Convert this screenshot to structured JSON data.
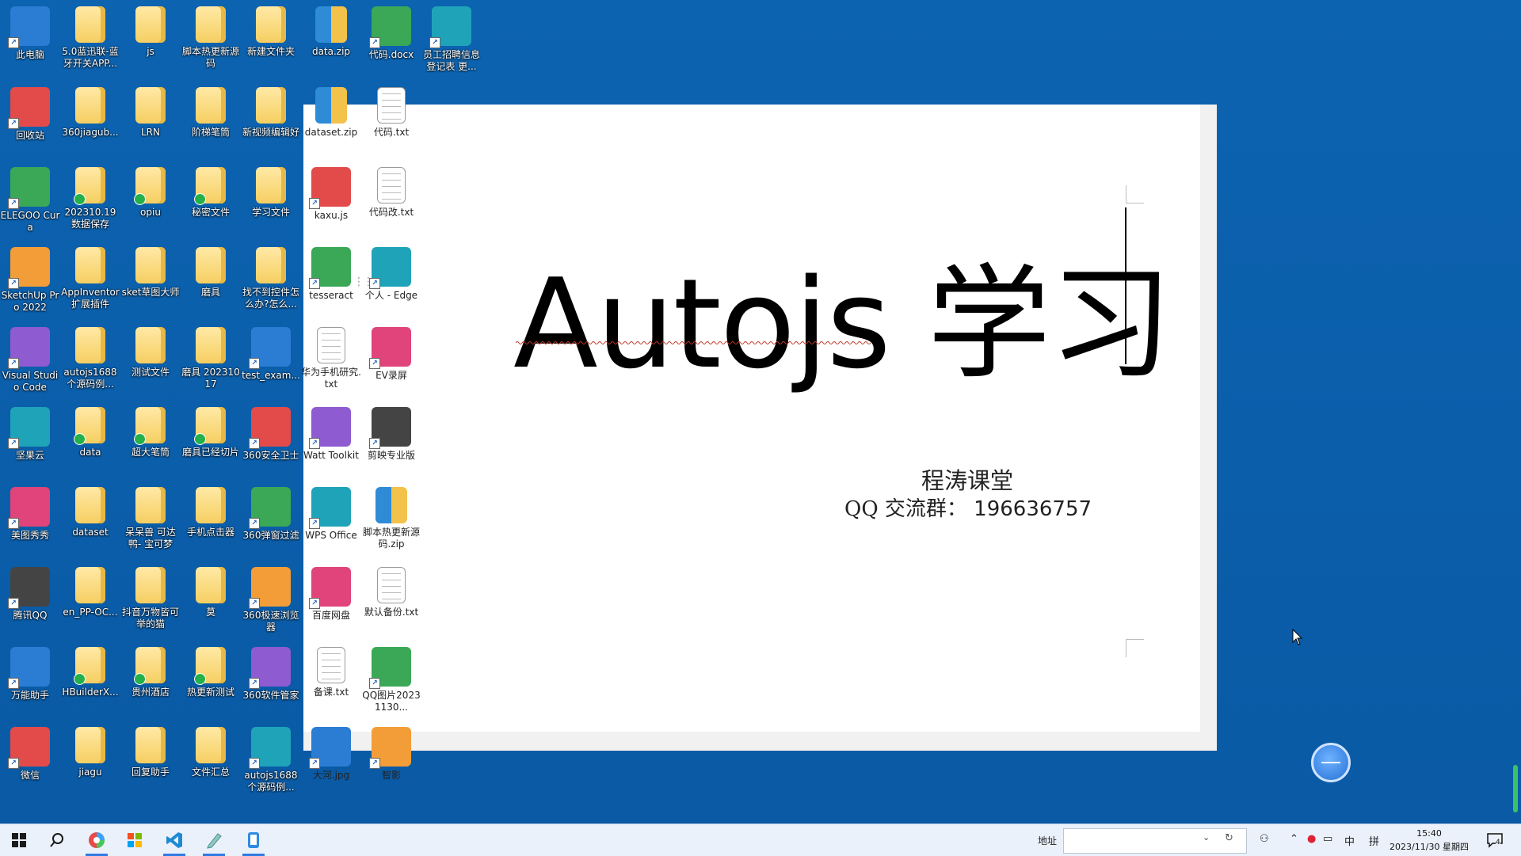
{
  "desktop": {
    "columns": [
      [
        "此电脑",
        "回收站",
        "ELEGOO Cura",
        "SketchUp Pro 2022",
        "Visual Studio Code",
        "坚果云",
        "美图秀秀",
        "腾讯QQ",
        "万能助手",
        "微信"
      ],
      [
        "5.0蓝迅联-蓝牙开关APP...",
        "360jiagub...",
        "202310.19数据保存",
        "AppInventor扩展插件",
        "autojs1688个源码例...",
        "data",
        "dataset",
        "en_PP-OC...",
        "HBuilderX...",
        "jiagu"
      ],
      [
        "js",
        "LRN",
        "opiu",
        "sket草图大师",
        "测试文件",
        "超大笔筒",
        "呆呆兽 可达鸭- 宝可梦",
        "抖音万物皆可举的猫",
        "贵州酒店",
        "回复助手"
      ],
      [
        "脚本热更新源码",
        "阶梯笔筒",
        "秘密文件",
        "磨具",
        "磨具 20231017",
        "磨具已经切片",
        "手机点击器",
        "莫",
        "热更新测试",
        "文件汇总"
      ],
      [
        "新建文件夹",
        "新视频编辑好",
        "学习文件",
        "找不到控件怎么办?怎么...",
        "test_exam...",
        "360安全卫士",
        "360弹窗过滤",
        "360极速浏览器",
        "360软件管家",
        "autojs1688个源码例..."
      ],
      [
        "data.zip",
        "dataset.zip",
        "kaxu.js",
        "tesseract",
        "华为手机研究.txt",
        "Watt Toolkit",
        "WPS Office",
        "百度网盘",
        "备课.txt",
        "大河.jpg"
      ],
      [
        "代码.docx",
        "代码.txt",
        "代码改.txt",
        "个人 - Edge",
        "EV录屏",
        "剪映专业版",
        "脚本热更新源码.zip",
        "默认备份.txt",
        "QQ图片20231130...",
        "智影"
      ],
      [
        "员工招聘信息登记表 更..."
      ]
    ]
  },
  "document": {
    "title_latin": "Autojs",
    "title_cn": "学习",
    "subtitle_line1": "程涛课堂",
    "subtitle_line2_label": "QQ 交流群：",
    "subtitle_line2_number": "196636757"
  },
  "taskbar": {
    "address_label": "地址",
    "address_value": "",
    "ime_label": "中",
    "ime_grid": "拼",
    "clock_time": "15:40",
    "clock_date": "2023/11/30 星期四",
    "notification_count": "4"
  },
  "colors": {
    "desktop_bg": "#0a5ea9",
    "taskbar_bg": "#eaf1fb",
    "accent": "#2f7be4",
    "squiggle": "#c0392b"
  }
}
